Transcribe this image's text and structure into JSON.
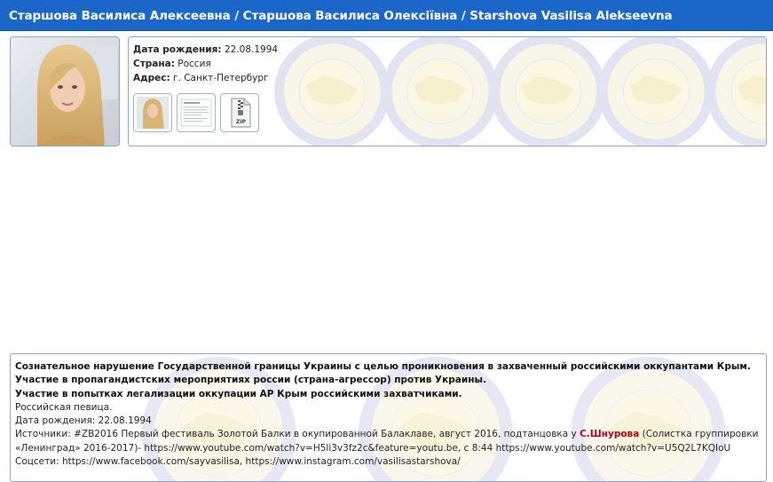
{
  "header": {
    "title": "Старшова Василиса Алексеевна / Старшова Василиса Олексіївна / Starshova Vasilisa Alekseevna"
  },
  "profile": {
    "birth_label": "Дата рождения:",
    "birth_value": "22.08.1994",
    "country_label": "Страна:",
    "country_value": "Россия",
    "address_label": "Адрес:",
    "address_value": "г. Санкт-Петербург",
    "attachments": [
      {
        "kind": "photo-thumbnail"
      },
      {
        "kind": "document-thumbnail"
      },
      {
        "kind": "zip-file",
        "badge": "ZIP"
      }
    ]
  },
  "description": {
    "bold_lines": [
      "Сознательное нарушение Государственной границы Украины с целью проникновения в захваченный российскими оккупантами Крым.",
      "Участие в пропагандистских мероприятиях россии (страна-агрессор) против Украины.",
      "Участие в попытках легализации оккупации АР Крым российскими захватчиками."
    ],
    "occupation": "Российская певица.",
    "birth_line": "Дата рождения: 22.08.1994",
    "sources_prefix": "Источники: #ZB2016 Первый фестиваль Золотой Балки в окупированной Балаклаве, август 2016, подтанцовка у ",
    "sources_link": "С.Шнурова",
    "sources_suffix": " (Солистка группировки «Ленинград» 2016-2017)- https://www.youtube.com/watch?v=H5li3v3fz2c&feature=youtu.be, с 8:44 https://www.youtube.com/watch?v=U5Q2L7KQIoU",
    "social": "Соцсети: https://www.facebook.com/sayvasilisa, https://www.instagram.com/vasilisastarshova/"
  },
  "colors": {
    "header_bg": "#1a67c9",
    "border": "#8ca3cf",
    "link_red": "#b00020"
  }
}
